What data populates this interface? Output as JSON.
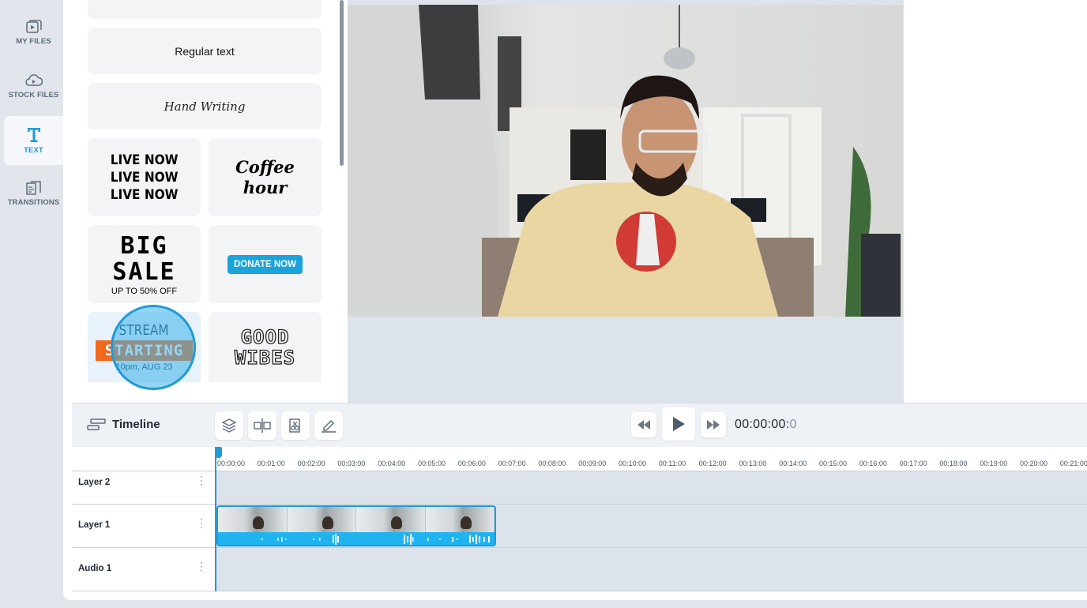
{
  "sidebar": {
    "items": [
      {
        "label": "MY FILES",
        "icon": "play-file-icon"
      },
      {
        "label": "STOCK FILES",
        "icon": "cloud-play-icon"
      },
      {
        "label": "TEXT",
        "icon": "text-t-icon",
        "active": true
      },
      {
        "label": "TRANSITIONS",
        "icon": "transitions-icon"
      }
    ]
  },
  "text_presets": {
    "regular": "Regular text",
    "handwriting": "Hand Writing",
    "live": [
      "LIVE NOW",
      "LIVE NOW",
      "LIVE NOW"
    ],
    "coffee": [
      "Coffee",
      "hour"
    ],
    "big_sale": [
      "BIG",
      "SALE"
    ],
    "big_sale_sub": "UP TO 50% OFF",
    "donate": "DONATE NOW",
    "stream": [
      "STREAM",
      "STARTING"
    ],
    "stream_sub": "10pm, AUG 23",
    "good_vibes": [
      "GOOD",
      "WIBES"
    ]
  },
  "timeline": {
    "title": "Timeline",
    "tools": [
      "layers-icon",
      "split-icon",
      "cut-icon",
      "edit-icon"
    ],
    "timecode_main": "00:00:00:",
    "timecode_frame": "0",
    "ruler": [
      "00:00:00",
      "00:01:00",
      "00:02:00",
      "00:03:00",
      "00:04:00",
      "00:05:00",
      "00:06:00",
      "00:07:00",
      "00:08:00",
      "00:09:00",
      "00:10:00",
      "00:11:00",
      "00:12:00",
      "00:13:00",
      "00:14:00",
      "00:15:00",
      "00:16:00",
      "00:17:00",
      "00:18:00",
      "00:19:00",
      "00:20:00",
      "00:21:00"
    ],
    "tracks": [
      "Layer 2",
      "Layer 1",
      "Audio 1"
    ]
  },
  "colors": {
    "accent": "#1f9bd7",
    "rail_bg": "#e2e6ec",
    "preview_bg": "#dce3ea",
    "track_bg": "#dde3ea"
  }
}
